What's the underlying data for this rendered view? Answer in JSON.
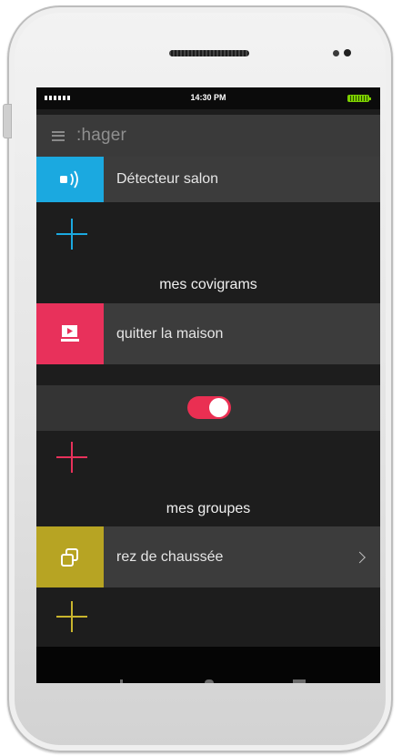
{
  "status_bar": {
    "time": "14:30 PM"
  },
  "app_bar": {
    "logo": ":hager"
  },
  "devices": {
    "item_label": "Détecteur salon",
    "tile_color": "#1ba9e0",
    "add_color": "#1ba9e0"
  },
  "covigrams": {
    "title": "mes covigrams",
    "item_label": "quitter la maison",
    "tile_color": "#e8315b",
    "toggle_on": true,
    "add_color": "#e8315b"
  },
  "groups": {
    "title": "mes groupes",
    "item_label": "rez de chaussée",
    "tile_color": "#b7a423",
    "add_color": "#c9b52d"
  },
  "icons": [
    "menu-icon",
    "motion-detector-icon",
    "play-screen-icon",
    "copy-group-icon",
    "chevron-right-icon",
    "plus-icon"
  ]
}
